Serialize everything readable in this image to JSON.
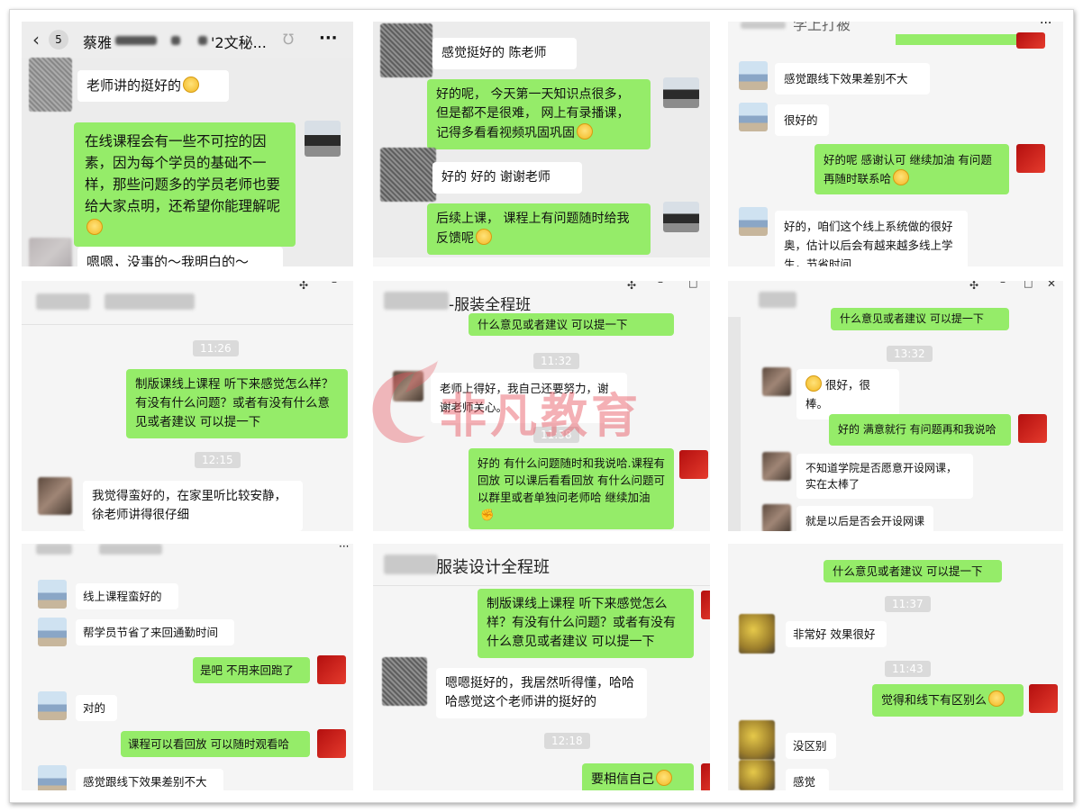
{
  "watermark": {
    "text": "非凡教育"
  },
  "panels": {
    "p1": {
      "back_count": "5",
      "title_prefix": "蔡雅",
      "title_suffix": "'2文秘...",
      "more": "···",
      "messages": [
        "老师讲的挺好的",
        "在线课程会有一些不可控的因素，因为每个学员的基础不一样，那些问题多的学员老师也要给大家点明，还希望你能理解呢",
        "嗯嗯，没事的～我明白的～"
      ]
    },
    "p2": {
      "messages": [
        "感觉挺好的 陈老师",
        "好的呢， 今天第一天知识点很多， 但是都不是很难， 网上有录播课， 记得多看看视频巩固巩固",
        "好的 好的 谢谢老师",
        "后续上课， 课程上有问题随时给我反馈呢"
      ]
    },
    "p3": {
      "title": "学上打被",
      "more": "···",
      "messages": [
        "感觉跟线下效果差别不大",
        "很好的",
        "好的呢  感谢认可  继续加油  有问题再随时联系哈",
        "好的，咱们这个线上系统做的很好奥，估计以后会有越来越多线上学生，节省时间"
      ]
    },
    "p4": {
      "time1": "11:26",
      "time2": "12:15",
      "messages": [
        "制版课线上课程 听下来感觉怎么样？有没有什么问题？或者有没有什么意见或者建议    可以提一下",
        "我觉得蛮好的，在家里听比较安静，徐老师讲得很仔细"
      ]
    },
    "p5": {
      "title": "-服装全程班",
      "time1": "11:32",
      "time2": "11:38",
      "messages": [
        "什么意见或者建议    可以提一下",
        "老师上得好，我自己还要努力，谢谢老师关心。",
        "好的    有什么问题随时和我说哈.课程有回放  可以课后看看回放    有什么问题可以群里或者单独问老师哈    继续加油"
      ]
    },
    "p6": {
      "time1": "13:32",
      "messages": [
        "什么意见或者建议    可以提一下",
        "很好，很棒。",
        "好的  满意就行  有问题再和我说哈",
        "不知道学院是否愿意开设网课，实在太棒了",
        "就是以后是否会开设网课"
      ]
    },
    "p7": {
      "more": "···",
      "messages": [
        "线上课程蛮好的",
        "帮学员节省了来回通勤时间",
        "是吧 不用来回跑了",
        "对的",
        "课程可以看回放  可以随时观看哈",
        "感觉跟线下效果差别不大"
      ]
    },
    "p8": {
      "title": "服装设计全程班",
      "time1": "12:18",
      "messages": [
        "制版课线上课程  听下来感觉怎么样？有没有什么问题？或者有没有什么意见或者建议      可以提一下",
        "嗯嗯挺好的，我居然听得懂，哈哈哈感觉这个老师讲的挺好的",
        "要相信自己"
      ]
    },
    "p9": {
      "time1": "11:37",
      "time2": "11:43",
      "messages": [
        "什么意见或者建议    可以提一下",
        "非常好 效果很好",
        "觉得和线下有区别么",
        "没区别",
        "感觉"
      ]
    }
  }
}
